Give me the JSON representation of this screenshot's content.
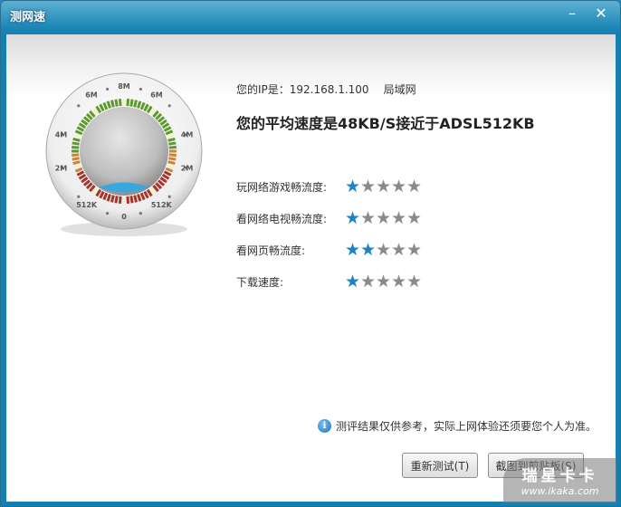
{
  "window": {
    "title": "测网速",
    "minimize_icon": "minimize-icon",
    "close_icon": "close-icon"
  },
  "gauge": {
    "labels_left": [
      "6M",
      "4M",
      "2M",
      "512K"
    ],
    "labels_right": [
      "6M",
      "4M",
      "2M",
      "512K"
    ],
    "top": "8M",
    "bottom": "0",
    "level_color": "#3aa6e0"
  },
  "info": {
    "ip_label": "您的IP是：192.168.1.100",
    "network_type": "局域网",
    "average": "您的平均速度是48KB/S接近于ADSL512KB"
  },
  "ratings": [
    {
      "label": "玩网络游戏畅流度:",
      "stars": 1,
      "max": 5
    },
    {
      "label": "看网络电视畅流度:",
      "stars": 1,
      "max": 5
    },
    {
      "label": "看网页畅流度:",
      "stars": 2,
      "max": 5
    },
    {
      "label": "下载速度:",
      "stars": 1,
      "max": 5
    }
  ],
  "note": "测评结果仅供参考，实际上网体验还须要您个人为准。",
  "buttons": {
    "retest": "重新测试(T)",
    "screenshot": "截图到剪贴板(S)"
  },
  "watermark": {
    "brand": "瑞星卡卡",
    "url": "www.ikaka.com"
  },
  "colors": {
    "accent": "#1b83c6",
    "titlebar": "#1580b0"
  }
}
